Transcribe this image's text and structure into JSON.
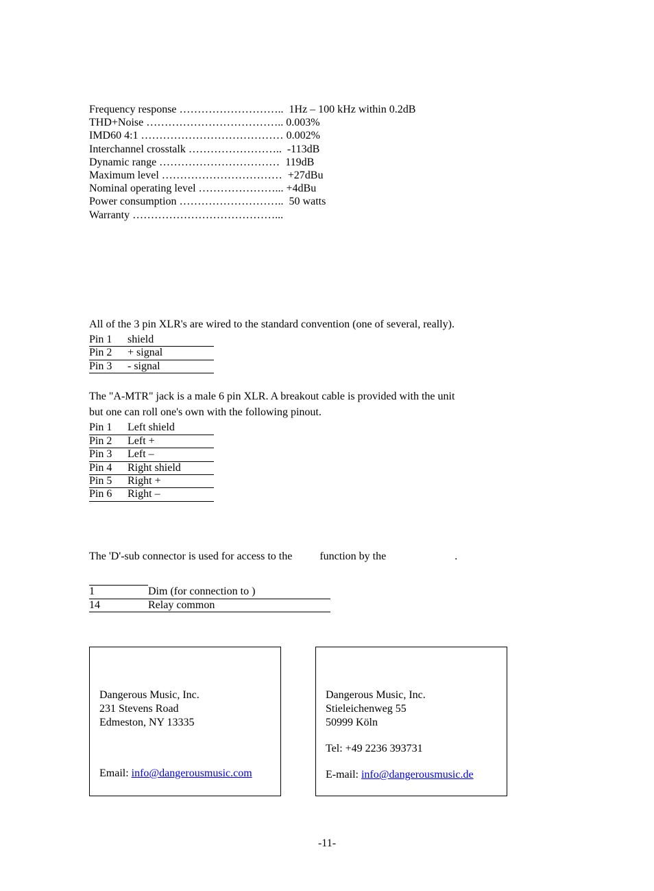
{
  "specs": [
    {
      "label": "Frequency response ………………………..  ",
      "value": "1Hz – 100 kHz within 0.2dB"
    },
    {
      "label": "THD+Noise ……………………………….. ",
      "value": "0.003%"
    },
    {
      "label": "IMD60 4:1 ………………………………… ",
      "value": "0.002%"
    },
    {
      "label": "Interchannel crosstalk ……………………..  ",
      "value": "-113dB"
    },
    {
      "label": "Dynamic range ……………………………  ",
      "value": "119dB"
    },
    {
      "label": "Maximum level ……………………………  ",
      "value": "+27dBu"
    },
    {
      "label": "Nominal operating level …………………... ",
      "value": "+4dBu"
    },
    {
      "label": "Power consumption ………………………..  ",
      "value": "50 watts"
    },
    {
      "label": "Warranty …………………………………...",
      "value": ""
    }
  ],
  "xlr3": {
    "intro": "All of the 3 pin XLR's are wired to the standard convention (one of several, really).",
    "rows": [
      {
        "pin": "Pin 1",
        "val": "shield"
      },
      {
        "pin": "Pin 2",
        "val": "+ signal"
      },
      {
        "pin": "Pin 3",
        "val": "- signal"
      }
    ]
  },
  "xlr6": {
    "intro1": "The \"A-MTR\" jack is a male 6 pin XLR. A breakout cable is provided with the unit",
    "intro2": "but one can roll one's own with the following pinout.",
    "rows": [
      {
        "pin": "Pin 1",
        "val": "Left shield"
      },
      {
        "pin": "Pin 2",
        "val": "Left +"
      },
      {
        "pin": "Pin 3",
        "val": "Left –"
      },
      {
        "pin": "Pin 4",
        "val": "Right shield"
      },
      {
        "pin": "Pin 5",
        "val": "Right +"
      },
      {
        "pin": "Pin 6",
        "val": "Right –"
      }
    ]
  },
  "dsub": {
    "intro_pre": "The 'D'-sub connector is used for access to the ",
    "intro_mid": "         function by the ",
    "intro_post": "                        .",
    "rows": [
      {
        "pin": "1",
        "val": "Dim (for connection to        )"
      },
      {
        "pin": "14",
        "val": "Relay common"
      }
    ]
  },
  "contact_us": {
    "line1": "Dangerous Music, Inc.",
    "line2": "231 Stevens Road",
    "line3": "Edmeston, NY 13335",
    "email_label": "Email:  ",
    "email": "info@dangerousmusic.com"
  },
  "contact_de": {
    "line1": "Dangerous Music, Inc.",
    "line2": "Stieleichenweg 55",
    "line3": "50999 Köln",
    "tel": "Tel: +49 2236 393731",
    "email_label": "E-mail: ",
    "email": "info@dangerousmusic.de"
  },
  "page_number": "-11-"
}
